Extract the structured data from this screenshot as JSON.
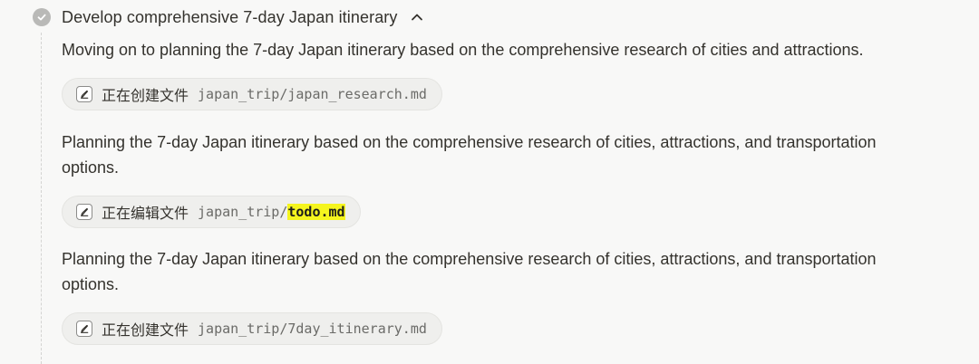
{
  "step": {
    "title": "Develop comprehensive 7-day Japan itinerary",
    "status_icon": "check-circle-icon",
    "toggle_icon": "chevron-up-icon"
  },
  "entries": [
    {
      "text": "Moving on to planning the 7-day Japan itinerary based on the comprehensive research of cities and attractions.",
      "tool": {
        "icon": "edit-file-icon",
        "action": "正在创建文件",
        "path": "japan_trip/",
        "file": "japan_research.md",
        "highlighted": false
      }
    },
    {
      "text": "Planning the 7-day Japan itinerary based on the comprehensive research of cities, attractions, and transportation options.",
      "tool": {
        "icon": "edit-file-icon",
        "action": "正在编辑文件",
        "path": "japan_trip/",
        "file": "todo.md",
        "highlighted": true
      }
    },
    {
      "text": "Planning the 7-day Japan itinerary based on the comprehensive research of cities, attractions, and transportation options.",
      "tool": {
        "icon": "edit-file-icon",
        "action": "正在创建文件",
        "path": "japan_trip/",
        "file": "7day_itinerary.md",
        "highlighted": false
      }
    }
  ],
  "colors": {
    "background": "#f8f8f7",
    "chip_background": "#efefed",
    "highlight": "#f5f51e"
  }
}
